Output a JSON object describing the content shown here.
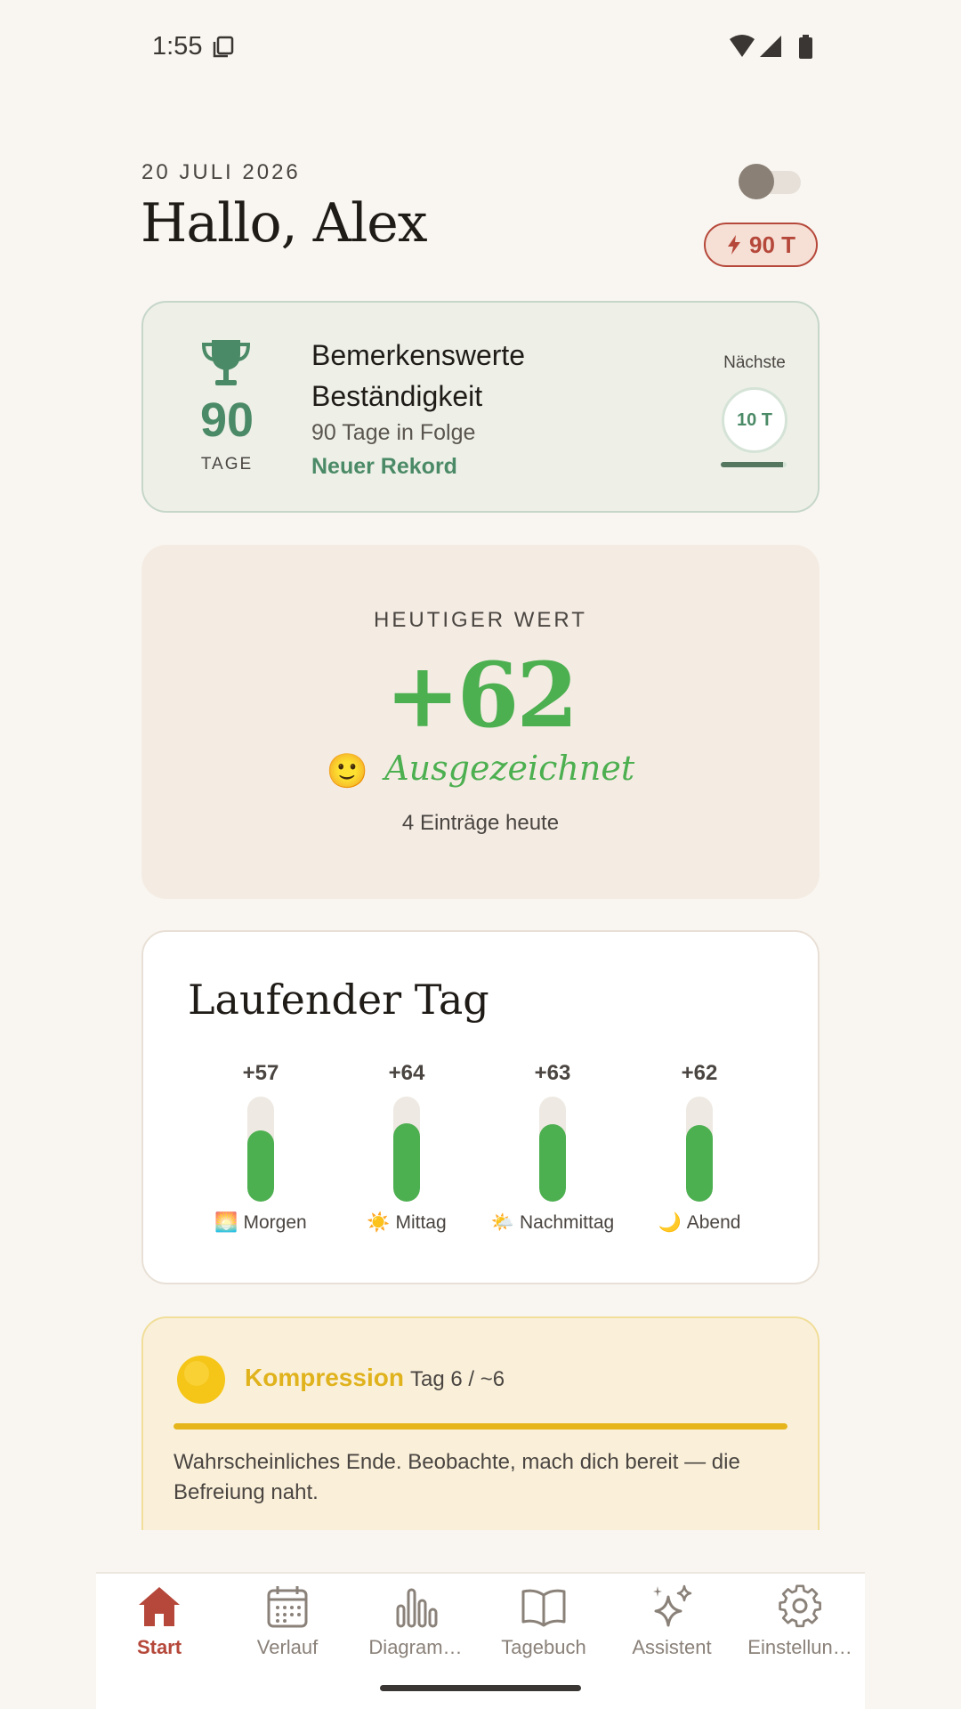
{
  "status_bar": {
    "time": "1:55"
  },
  "header": {
    "date": "20 JULI 2026",
    "greeting": "Hallo, Alex",
    "theme_toggle": "off",
    "streak_badge": "90 T"
  },
  "streak_card": {
    "days_value": "90",
    "days_label": "TAGE",
    "title": "Bemerkenswerte Beständigkeit",
    "subtitle": "90 Tage in Folge",
    "record_label": "Neuer Rekord",
    "next_label": "Nächste",
    "next_value": "10 T",
    "next_progress": 0.95
  },
  "today_card": {
    "label": "HEUTIGER WERT",
    "value": "+62",
    "mood_emoji": "🙂",
    "mood_text": "Ausgezeichnet",
    "entries": "4 Einträge heute"
  },
  "running_day": {
    "title": "Laufender Tag",
    "periods": [
      {
        "value": "+57",
        "emoji": "🌅",
        "label": "Morgen",
        "level": 0.57
      },
      {
        "value": "+64",
        "emoji": "☀️",
        "label": "Mittag",
        "level": 0.64
      },
      {
        "value": "+63",
        "emoji": "🌤️",
        "label": "Nachmittag",
        "level": 0.63
      },
      {
        "value": "+62",
        "emoji": "🌙",
        "label": "Abend",
        "level": 0.62
      }
    ]
  },
  "compression_card": {
    "emoji": "🟡",
    "title": "Kompression",
    "day": "Tag 6 / ~6",
    "progress": 1.0,
    "description": "Wahrscheinliches Ende. Beobachte, mach dich bereit — die Befreiung naht."
  },
  "bottom_nav": {
    "items": [
      {
        "label": "Start",
        "icon": "home-icon",
        "active": true
      },
      {
        "label": "Verlauf",
        "icon": "calendar-icon",
        "active": false
      },
      {
        "label": "Diagram…",
        "icon": "bar-chart-icon",
        "active": false
      },
      {
        "label": "Tagebuch",
        "icon": "book-icon",
        "active": false
      },
      {
        "label": "Assistent",
        "icon": "sparkles-icon",
        "active": false
      },
      {
        "label": "Einstellun…",
        "icon": "gear-icon",
        "active": false
      }
    ]
  },
  "colors": {
    "accent": "#b5483a",
    "positive": "#4caf50",
    "streak_green": "#4b8a66",
    "compression_yellow": "#e0b21c"
  }
}
